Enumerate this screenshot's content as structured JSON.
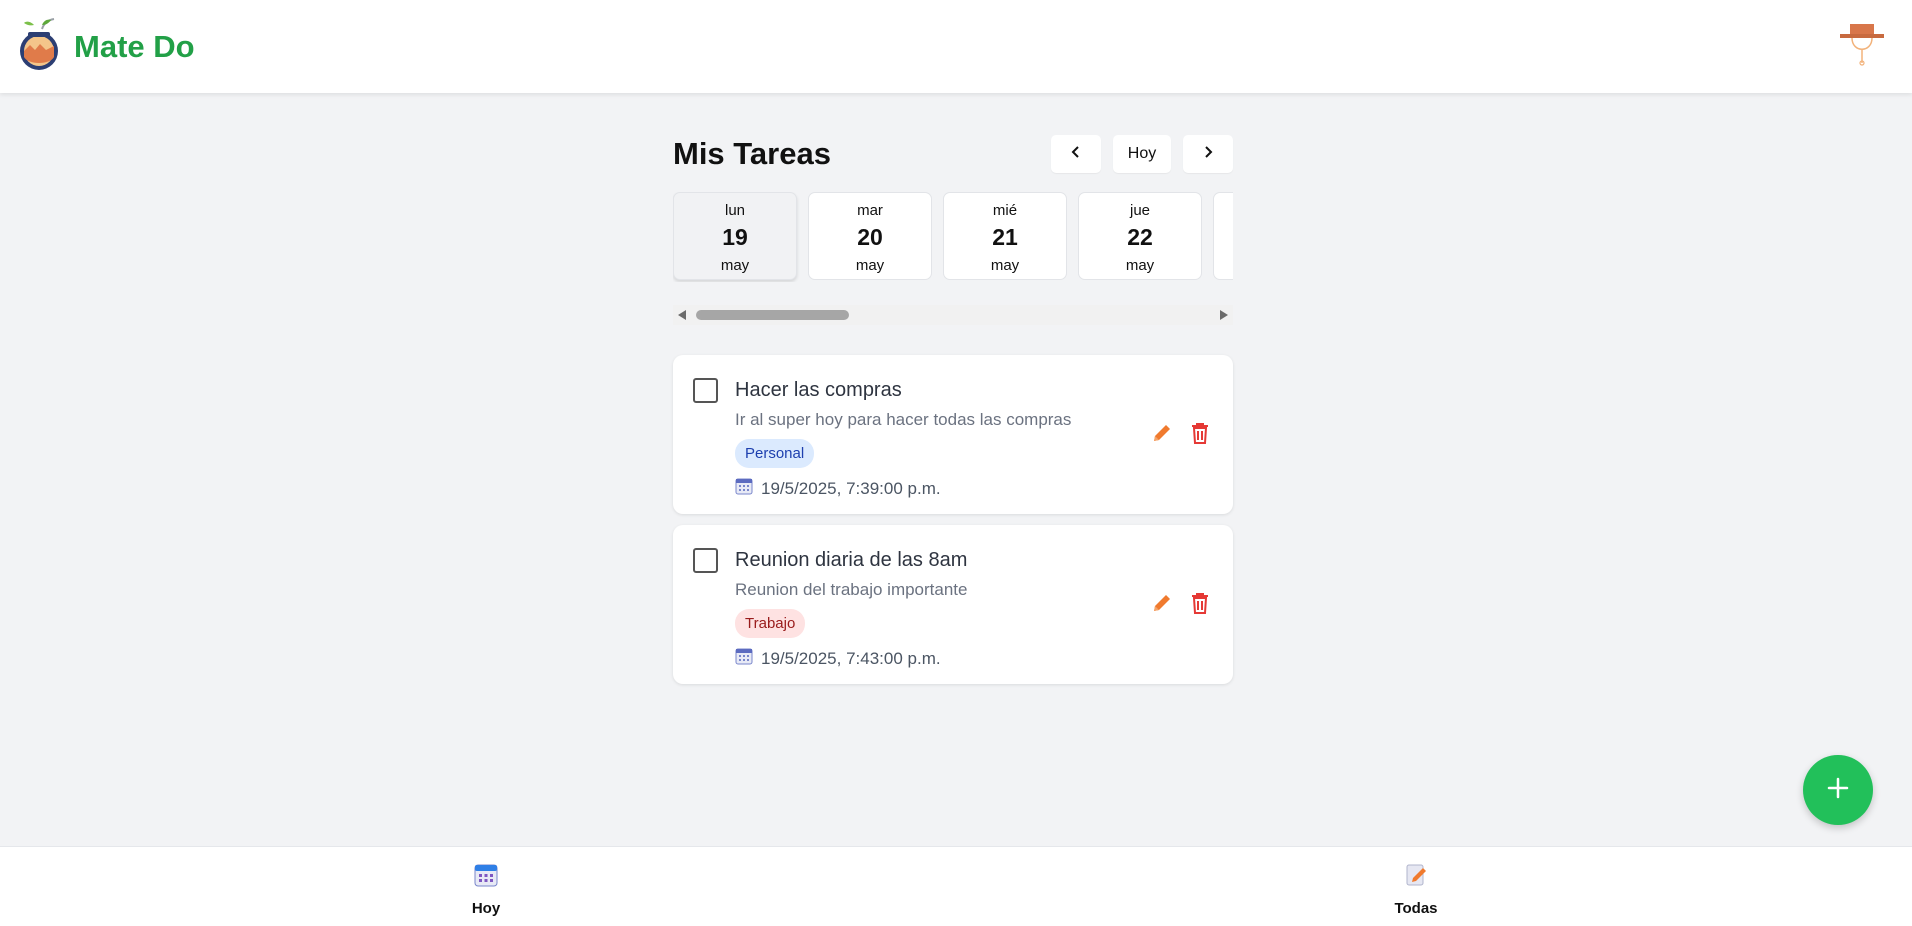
{
  "app": {
    "title": "Mate Do",
    "brand_color": "#22a047"
  },
  "header": {
    "logo_icon": "mate-gourd-icon",
    "avatar_icon": "gaucho-hat-avatar-icon"
  },
  "main": {
    "title": "Mis Tareas",
    "nav": {
      "prev_icon": "chevron-left-icon",
      "today_label": "Hoy",
      "next_icon": "chevron-right-icon"
    },
    "days": [
      {
        "dow": "lun",
        "num": "19",
        "month": "may",
        "selected": true
      },
      {
        "dow": "mar",
        "num": "20",
        "month": "may",
        "selected": false
      },
      {
        "dow": "mié",
        "num": "21",
        "month": "may",
        "selected": false
      },
      {
        "dow": "jue",
        "num": "22",
        "month": "may",
        "selected": false
      },
      {
        "dow": "",
        "num": "",
        "month": "",
        "selected": false
      }
    ],
    "tasks": [
      {
        "title": "Hacer las compras",
        "description": "Ir al super hoy para hacer todas las compras",
        "tag": "Personal",
        "date": "19/5/2025, 7:39:00 p.m.",
        "completed": false
      },
      {
        "title": "Reunion diaria de las 8am",
        "description": "Reunion del trabajo importante",
        "tag": "Trabajo",
        "date": "19/5/2025, 7:43:00 p.m.",
        "completed": false
      }
    ]
  },
  "fab": {
    "icon": "plus-icon",
    "color": "#22c05a"
  },
  "bottom_nav": {
    "items": [
      {
        "label": "Hoy",
        "icon": "calendar-icon"
      },
      {
        "label": "Todas",
        "icon": "notepad-pencil-icon"
      }
    ]
  },
  "colors": {
    "edit": "#f07a2e",
    "delete": "#e53935",
    "tag_personal_bg": "#dbeafe",
    "tag_trabajo_bg": "#fee2e2"
  }
}
